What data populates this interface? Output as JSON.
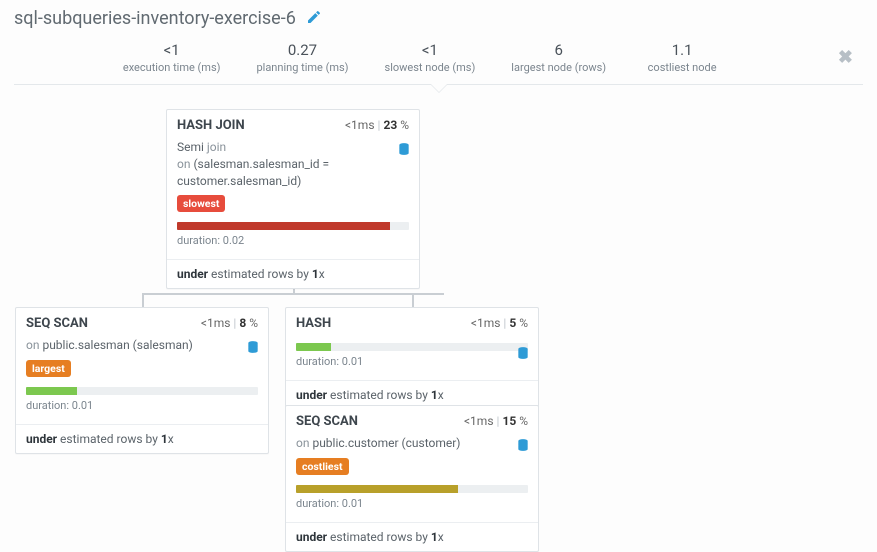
{
  "title": "sql-subqueries-inventory-exercise-6",
  "metrics": {
    "exec": {
      "val": "<1",
      "lbl": "execution time (ms)"
    },
    "plan": {
      "val": "0.27",
      "lbl": "planning time (ms)"
    },
    "slow": {
      "val": "<1",
      "lbl": "slowest node (ms)"
    },
    "large": {
      "val": "6",
      "lbl": "largest node (rows)"
    },
    "cost": {
      "val": "1.1",
      "lbl": "costliest node"
    }
  },
  "nodes": {
    "hashjoin": {
      "title": "HASH JOIN",
      "time": "<1",
      "timeUnit": "ms",
      "pct": "23",
      "line1a": "Semi ",
      "line1b": "join",
      "line2a": "on ",
      "line2b": "(salesman.salesman_id = customer.salesman_id)",
      "tag": "slowest",
      "dur_lbl": "duration: ",
      "dur_val": "0.02",
      "foot_a": "under",
      "foot_b": " estimated rows by ",
      "foot_c": "1",
      "foot_d": "x"
    },
    "seqscan_salesman": {
      "title": "SEQ SCAN",
      "time": "<1",
      "timeUnit": "ms",
      "pct": "8",
      "line2a": "on ",
      "line2b": "public.salesman (salesman)",
      "tag": "largest",
      "dur_lbl": "duration: ",
      "dur_val": "0.01",
      "foot_a": "under",
      "foot_b": " estimated rows by ",
      "foot_c": "1",
      "foot_d": "x"
    },
    "hash": {
      "title": "HASH",
      "time": "<1",
      "timeUnit": "ms",
      "pct": "5",
      "dur_lbl": "duration: ",
      "dur_val": "0.01",
      "foot_a": "under",
      "foot_b": " estimated rows by ",
      "foot_c": "1",
      "foot_d": "x"
    },
    "seqscan_customer": {
      "title": "SEQ SCAN",
      "time": "<1",
      "timeUnit": "ms",
      "pct": "15",
      "line2a": "on ",
      "line2b": "public.customer (customer)",
      "tag": "costliest",
      "dur_lbl": "duration: ",
      "dur_val": "0.01",
      "foot_a": "under",
      "foot_b": " estimated rows by ",
      "foot_c": "1",
      "foot_d": "x"
    }
  }
}
